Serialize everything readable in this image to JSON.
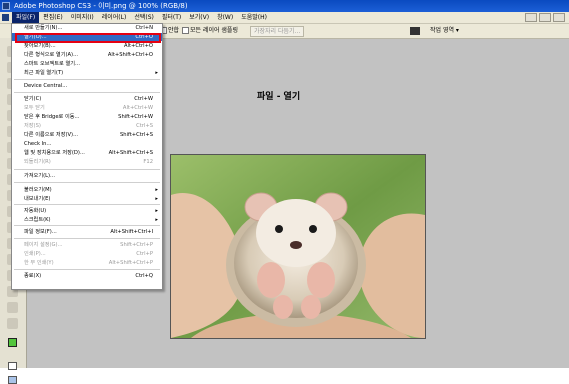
{
  "titlebar": {
    "text": "Adobe Photoshop CS3 - 이미.png @ 100% (RGB/8)"
  },
  "menubar": {
    "items": [
      "파일(F)",
      "편집(E)",
      "이미지(I)",
      "레이어(L)",
      "선택(S)",
      "필터(T)",
      "보기(V)",
      "창(W)",
      "도움말(H)"
    ]
  },
  "options": {
    "checkbox1_label": "안합",
    "checkbox2_label": "모든 레이어 샘플링",
    "button_label": "가장자리 다듬기...",
    "workspace_label": "작업 영역 ▾"
  },
  "document": {
    "heading": "파일 - 열기"
  },
  "file_menu": {
    "items": [
      {
        "label": "새로 만들기(N)...",
        "shortcut": "Ctrl+N",
        "arrow": "",
        "state": "normal"
      },
      {
        "label": "열기(O)...",
        "shortcut": "Ctrl+O",
        "arrow": "",
        "state": "highlighted"
      },
      {
        "label": "찾아보기(B)...",
        "shortcut": "Alt+Ctrl+O",
        "arrow": "",
        "state": "normal"
      },
      {
        "label": "다른 형식으로 열기(A)...",
        "shortcut": "Alt+Shift+Ctrl+O",
        "arrow": "",
        "state": "normal"
      },
      {
        "label": "스마트 오브젝트로 열기...",
        "shortcut": "",
        "arrow": "",
        "state": "normal"
      },
      {
        "label": "최근 파일 열기(T)",
        "shortcut": "",
        "arrow": "▸",
        "state": "normal"
      },
      {
        "label": "Device Central...",
        "shortcut": "",
        "arrow": "",
        "state": "normal"
      },
      {
        "label": "닫기(C)",
        "shortcut": "Ctrl+W",
        "arrow": "",
        "state": "normal"
      },
      {
        "label": "모두 닫기",
        "shortcut": "Alt+Ctrl+W",
        "arrow": "",
        "state": "disabled"
      },
      {
        "label": "닫은 후 Bridge로 이동...",
        "shortcut": "Shift+Ctrl+W",
        "arrow": "",
        "state": "normal"
      },
      {
        "label": "저장(S)",
        "shortcut": "Ctrl+S",
        "arrow": "",
        "state": "disabled"
      },
      {
        "label": "다른 이름으로 저장(V)...",
        "shortcut": "Shift+Ctrl+S",
        "arrow": "",
        "state": "normal"
      },
      {
        "label": "Check In...",
        "shortcut": "",
        "arrow": "",
        "state": "normal"
      },
      {
        "label": "웹 및 장치용으로 저장(D)...",
        "shortcut": "Alt+Shift+Ctrl+S",
        "arrow": "",
        "state": "normal"
      },
      {
        "label": "되돌리기(R)",
        "shortcut": "F12",
        "arrow": "",
        "state": "disabled"
      },
      {
        "label": "가져오기(L)...",
        "shortcut": "",
        "arrow": "",
        "state": "normal"
      },
      {
        "label": "불러오기(M)",
        "shortcut": "",
        "arrow": "▸",
        "state": "normal"
      },
      {
        "label": "내보내기(E)",
        "shortcut": "",
        "arrow": "▸",
        "state": "normal"
      },
      {
        "label": "자동화(U)",
        "shortcut": "",
        "arrow": "▸",
        "state": "normal"
      },
      {
        "label": "스크립트(K)",
        "shortcut": "",
        "arrow": "▸",
        "state": "normal"
      },
      {
        "label": "파일 정보(F)...",
        "shortcut": "Alt+Shift+Ctrl+I",
        "arrow": "",
        "state": "normal"
      },
      {
        "label": "페이지 설정(G)...",
        "shortcut": "Shift+Ctrl+P",
        "arrow": "",
        "state": "disabled"
      },
      {
        "label": "인쇄(P)...",
        "shortcut": "Ctrl+P",
        "arrow": "",
        "state": "disabled"
      },
      {
        "label": "한 부 인쇄(Y)",
        "shortcut": "Alt+Shift+Ctrl+P",
        "arrow": "",
        "state": "disabled"
      },
      {
        "label": "종료(X)",
        "shortcut": "Ctrl+Q",
        "arrow": "",
        "state": "normal"
      }
    ]
  }
}
